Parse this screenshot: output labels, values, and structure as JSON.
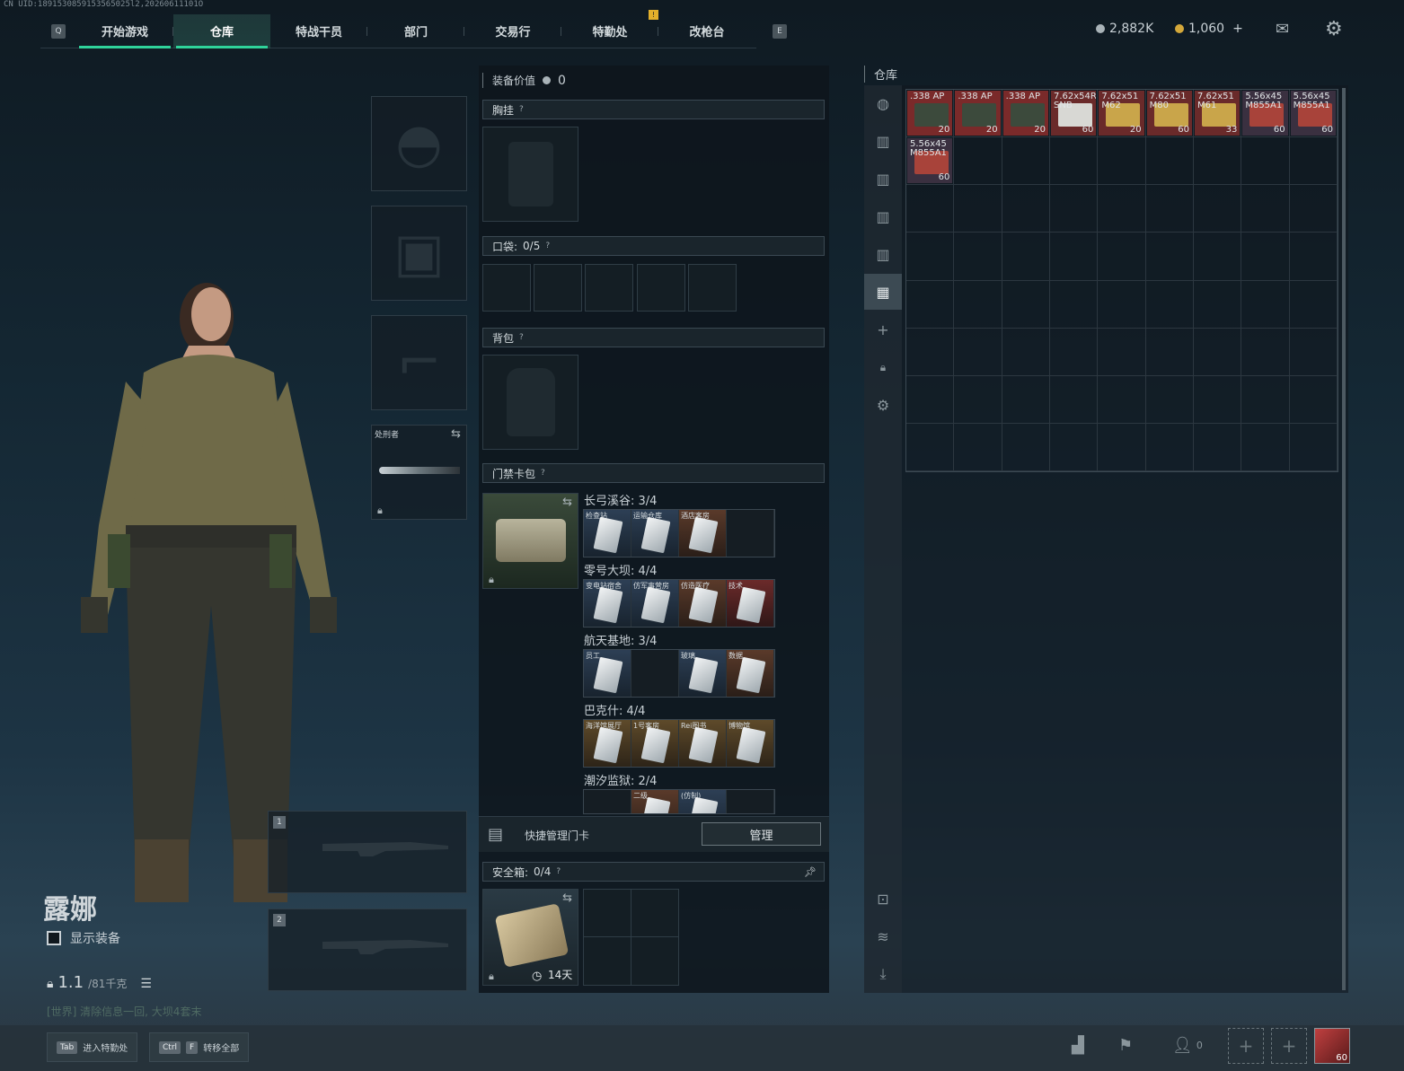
{
  "uid_line": "CN UID:1891530859153565025l2,20260611101O",
  "nav": {
    "key_left": "Q",
    "key_right": "E",
    "tabs": [
      {
        "label": "开始游戏"
      },
      {
        "label": "仓库"
      },
      {
        "label": "特战干员"
      },
      {
        "label": "部门"
      },
      {
        "label": "交易行"
      },
      {
        "label": "特勤处"
      },
      {
        "label": "改枪台"
      }
    ],
    "active_tab": "仓库",
    "notification": "!"
  },
  "currency": {
    "silver": "2,882K",
    "gold": "1,060",
    "gold_add": "+"
  },
  "operator": {
    "name": "露娜",
    "show_equip_label": "显示装备",
    "weight_value": "1.1",
    "weight_max": "/81千克",
    "world_msg": "[世界] 清除信息一回, 大坝4套末"
  },
  "equipment": {
    "melee_label": "处刑者",
    "weapon_slots": [
      "1",
      "2"
    ]
  },
  "middle": {
    "equip_value_label": "装备价值",
    "equip_value": "0",
    "chest_rig": "胸挂",
    "pocket_label": "口袋:",
    "pocket_count": "0/5",
    "backpack": "背包",
    "keycard_pack": "门禁卡包",
    "help": "?",
    "maps": [
      {
        "name": "长弓溪谷: 3/4",
        "cards": [
          {
            "label": "检查站",
            "tone": "blue"
          },
          {
            "label": "运输仓库",
            "tone": "blue"
          },
          {
            "label": "酒店客房",
            "tone": "brown"
          },
          {
            "label": "",
            "tone": "empty"
          }
        ]
      },
      {
        "name": "零号大坝: 4/4",
        "cards": [
          {
            "label": "变电站宿舍",
            "tone": "blue"
          },
          {
            "label": "仿军事营房",
            "tone": "blue"
          },
          {
            "label": "仿造医疗",
            "tone": "brown"
          },
          {
            "label": "技术",
            "tone": "red"
          }
        ]
      },
      {
        "name": "航天基地: 3/4",
        "cards": [
          {
            "label": "员工",
            "tone": "blue"
          },
          {
            "label": "",
            "tone": "empty"
          },
          {
            "label": "玻璃",
            "tone": "blue"
          },
          {
            "label": "数据",
            "tone": "brown"
          }
        ]
      },
      {
        "name": "巴克什: 4/4",
        "cards": [
          {
            "label": "海洋馆展厅",
            "tone": "gold"
          },
          {
            "label": "1号客房",
            "tone": "gold"
          },
          {
            "label": "Rei图书",
            "tone": "gold"
          },
          {
            "label": "博物馆",
            "tone": "gold"
          }
        ]
      },
      {
        "name": "潮汐监狱: 2/4",
        "cards": [
          {
            "label": "",
            "tone": "empty"
          },
          {
            "label": "二级",
            "tone": "brown"
          },
          {
            "label": "(仿制)",
            "tone": "blue"
          },
          {
            "label": "",
            "tone": "empty"
          }
        ]
      }
    ],
    "quick_manage_label": "快捷管理门卡",
    "manage_button": "管理",
    "safe_box_label": "安全箱:",
    "safe_box_count": "0/4",
    "safe_box_days": "14天"
  },
  "warehouse": {
    "title": "仓库",
    "items": [
      {
        "name": ".338 AP",
        "qty": "20",
        "color": "#7a2a2a",
        "img": "#3c4a3c"
      },
      {
        "name": ".338 AP",
        "qty": "20",
        "color": "#7a2a2a",
        "img": "#3c4a3c"
      },
      {
        "name": ".338 AP",
        "qty": "20",
        "color": "#7a2a2a",
        "img": "#3c4a3c"
      },
      {
        "name": "7.62x54R SNB",
        "qty": "60",
        "color": "#6a2a2a",
        "img": "#d8d8d4"
      },
      {
        "name": "7.62x51 M62",
        "qty": "20",
        "color": "#6a2a2a",
        "img": "#c9a54a"
      },
      {
        "name": "7.62x51 M80",
        "qty": "60",
        "color": "#6a2a2a",
        "img": "#c9a54a"
      },
      {
        "name": "7.62x51 M61",
        "qty": "33",
        "color": "#6a2a2a",
        "img": "#c9a54a"
      },
      {
        "name": "5.56x45 M855A1",
        "qty": "60",
        "color": "#3a3040",
        "img": "#a8433a"
      },
      {
        "name": "5.56x45 M855A1",
        "qty": "60",
        "color": "#3a3040",
        "img": "#a8433a"
      },
      {
        "name": "5.56x45 M855A1",
        "qty": "60",
        "color": "#3a3040",
        "img": "#a8433a"
      }
    ]
  },
  "bottom": {
    "tab_key": "Tab",
    "tab_label": "进入特勤处",
    "ctrl_key": "Ctrl",
    "f_key": "F",
    "transfer_label": "转移全部",
    "friends_count": "0",
    "avatar_level": "60"
  }
}
